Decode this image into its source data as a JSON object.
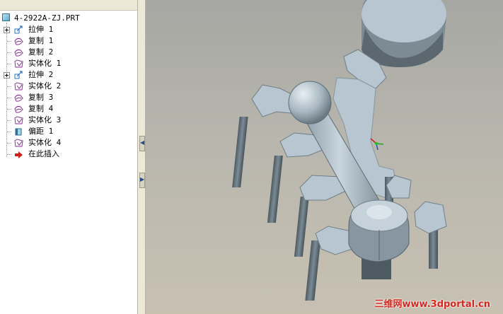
{
  "tree": {
    "root": "4-2922A-ZJ.PRT",
    "items": [
      {
        "label": "拉伸 1",
        "icon": "extrude-icon",
        "expandable": true
      },
      {
        "label": "复制 1",
        "icon": "copy-icon",
        "expandable": false
      },
      {
        "label": "复制 2",
        "icon": "copy-icon",
        "expandable": false
      },
      {
        "label": "实体化 1",
        "icon": "solidify-icon",
        "expandable": false
      },
      {
        "label": "拉伸 2",
        "icon": "extrude-icon",
        "expandable": true
      },
      {
        "label": "实体化 2",
        "icon": "solidify-icon",
        "expandable": false
      },
      {
        "label": "复制 3",
        "icon": "copy-icon",
        "expandable": false
      },
      {
        "label": "复制 4",
        "icon": "copy-icon",
        "expandable": false
      },
      {
        "label": "实体化 3",
        "icon": "solidify-icon",
        "expandable": false
      },
      {
        "label": "偏距 1",
        "icon": "offset-icon",
        "expandable": false
      },
      {
        "label": "实体化 4",
        "icon": "solidify-icon",
        "expandable": false
      },
      {
        "label": "在此插入",
        "icon": "insert-here-arrow-icon",
        "expandable": false
      }
    ]
  },
  "colors": {
    "icon_purple": "#8a2c9a",
    "icon_blue": "#2a6fb8",
    "insert_arrow": "#d0201a",
    "model_fill": "#b7c6d0",
    "model_shadow": "#55626b",
    "watermark": "#d8261d"
  },
  "watermark": "三维网www.3dportal.cn"
}
